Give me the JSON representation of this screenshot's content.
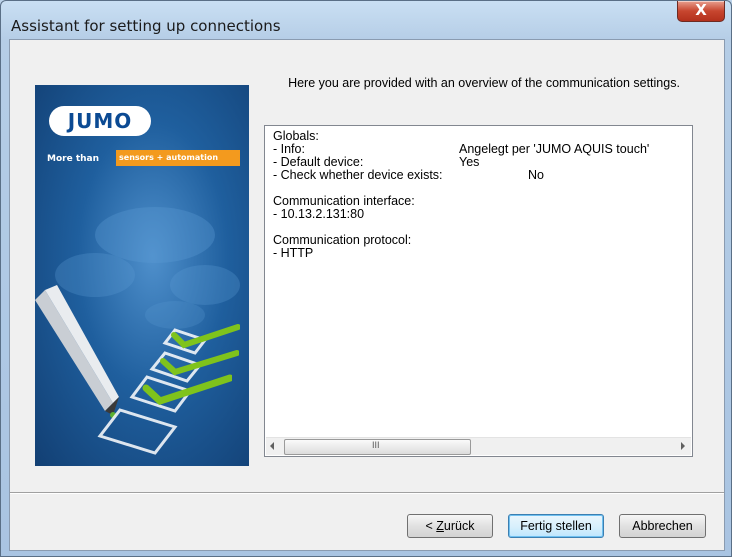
{
  "window": {
    "title": "Assistant for setting up connections",
    "close_symbol": "X"
  },
  "brand": {
    "logo": "JUMO",
    "tagline_prefix": "More than",
    "tagline_highlight": "sensors + automation",
    "colors": {
      "panel": "#1f5f9e",
      "accent": "#f39a1e",
      "check": "#7fc31c"
    }
  },
  "heading": "Here you are provided with an overview of the communication settings.",
  "overview": {
    "globals_title": "Globals:",
    "rows": [
      {
        "label": "- Info:",
        "value": "Angelegt per 'JUMO AQUIS touch'"
      },
      {
        "label": "- Default device:",
        "value": "Yes"
      },
      {
        "label": "- Check whether device exists:",
        "value": "No"
      }
    ],
    "interface_title": "Communication interface:",
    "interface_value": "- 10.13.2.131:80",
    "protocol_title": "Communication protocol:",
    "protocol_value": "- HTTP",
    "scroll_grip": "III"
  },
  "buttons": {
    "back_prefix": "< ",
    "back_mnemonic": "Z",
    "back_rest": "urück",
    "finish": "Fertig stellen",
    "cancel": "Abbrechen"
  }
}
